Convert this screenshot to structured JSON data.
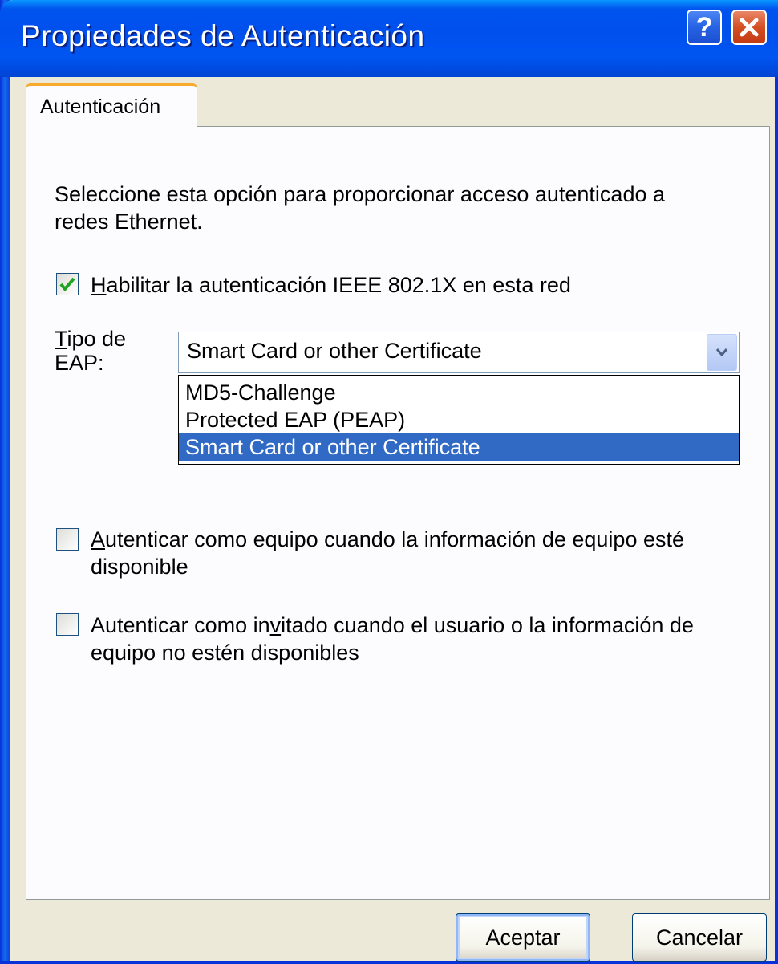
{
  "window": {
    "title": "Propiedades de Autenticación",
    "help_icon": "help-question-icon",
    "close_icon": "close-x-icon"
  },
  "tabs": [
    {
      "label": "Autenticación",
      "active": true
    }
  ],
  "main": {
    "description": "Seleccione esta opción para proporcionar acceso autenticado a redes Ethernet.",
    "description_line1": "Seleccione esta opción para proporcionar acceso autenticado a",
    "description_line2": "redes Ethernet.",
    "enable_checkbox": {
      "label": "Habilitar la autenticación IEEE 802.1X en esta red",
      "label_first": "H",
      "label_rest": "abilitar la autenticación IEEE 802.1X en esta red",
      "checked": true
    },
    "eap_label_line1": "Tipo de",
    "eap_label_line2": "EAP:",
    "eap_label_first": "T",
    "eap_label_rest": "ipo de",
    "eap_select": {
      "value": "Smart Card or other Certificate",
      "options": [
        "MD5-Challenge",
        "Protected EAP (PEAP)",
        "Smart Card or other Certificate"
      ],
      "selected_index": 2
    },
    "computer_checkbox": {
      "label_first": "A",
      "label_line1_rest": "utenticar como equipo cuando la información de equipo esté",
      "label_line2": "disponible",
      "checked": false
    },
    "guest_checkbox": {
      "label_line1_pre": "Autenticar como in",
      "label_line1_u": "v",
      "label_line1_post": "itado cuando el usuario o la información de",
      "label_line2": "equipo no estén disponibles",
      "checked": false
    }
  },
  "footer": {
    "ok_label": "Aceptar",
    "cancel_label": "Cancelar"
  },
  "colors": {
    "titlebar": "#0055F1",
    "tab_highlight": "#F8AA2C",
    "selection": "#316AC5",
    "checkmark": "#21A121"
  }
}
